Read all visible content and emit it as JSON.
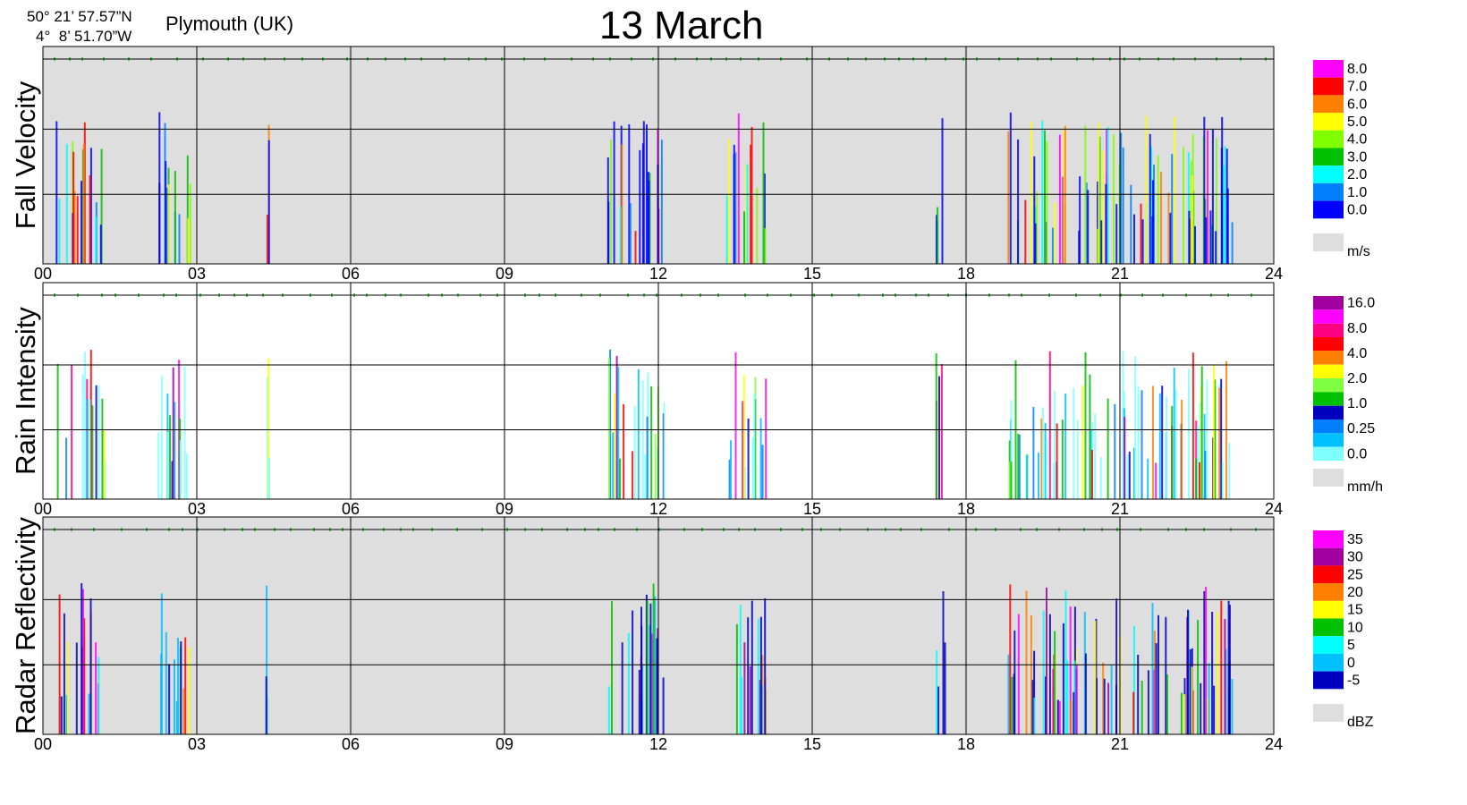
{
  "header": {
    "coord_lat": "50° 21’ 57.57”N",
    "coord_lon": "4°  8’ 51.70”W",
    "location": "Plymouth (UK)",
    "title": "13 March"
  },
  "chart_data": [
    {
      "type": "heatmap",
      "ylabel": "Fall Velocity",
      "xlabel": "",
      "x_ticks": [
        "00",
        "03",
        "06",
        "09",
        "12",
        "15",
        "18",
        "21",
        "24"
      ],
      "xlim": [
        0,
        24
      ],
      "background": "#dedede",
      "colorbar": {
        "unit": "m/s",
        "no_data_color": "#dedede",
        "labels": [
          "8.0",
          "7.0",
          "6.0",
          "5.0",
          "4.0",
          "3.0",
          "2.0",
          "1.0",
          "0.0"
        ],
        "colors": [
          "#ff00ff",
          "#ff0000",
          "#ff8000",
          "#ffff00",
          "#80ff00",
          "#00c000",
          "#00ffff",
          "#0080ff",
          "#0000ff"
        ]
      },
      "precip_intervals_h": [
        [
          0.25,
          1.2
        ],
        [
          2.2,
          2.9
        ],
        [
          4.3,
          4.4
        ],
        [
          11.0,
          12.1
        ],
        [
          13.3,
          14.1
        ],
        [
          17.4,
          17.6
        ],
        [
          18.8,
          23.2
        ]
      ]
    },
    {
      "type": "heatmap",
      "ylabel": "Rain Intensity",
      "xlabel": "",
      "x_ticks": [
        "00",
        "03",
        "06",
        "09",
        "12",
        "15",
        "18",
        "21",
        "24"
      ],
      "xlim": [
        0,
        24
      ],
      "background": "#ffffff",
      "colorbar": {
        "unit": "mm/h",
        "no_data_color": "#dedede",
        "labels": [
          "16.0",
          "8.0",
          "4.0",
          "2.0",
          "1.0",
          "0.25",
          "0.0"
        ],
        "colors": [
          "#a000a0",
          "#ff00ff",
          "#ff0080",
          "#ff0000",
          "#ff8000",
          "#ffff00",
          "#80ff40",
          "#00c000",
          "#0000c0",
          "#0080ff",
          "#00c0ff",
          "#80ffff"
        ]
      },
      "precip_intervals_h": [
        [
          0.25,
          1.2
        ],
        [
          2.2,
          2.9
        ],
        [
          4.3,
          4.4
        ],
        [
          11.0,
          12.1
        ],
        [
          13.3,
          14.1
        ],
        [
          17.4,
          17.6
        ],
        [
          18.8,
          23.2
        ]
      ]
    },
    {
      "type": "heatmap",
      "ylabel": "Radar Reflectivity",
      "xlabel": "",
      "x_ticks": [
        "00",
        "03",
        "06",
        "09",
        "12",
        "15",
        "18",
        "21",
        "24"
      ],
      "xlim": [
        0,
        24
      ],
      "background": "#dedede",
      "colorbar": {
        "unit": "dBZ",
        "no_data_color": "#dedede",
        "labels": [
          "35",
          "30",
          "25",
          "20",
          "15",
          "10",
          "5",
          "0",
          "-5"
        ],
        "colors": [
          "#ff00ff",
          "#a000a0",
          "#ff0000",
          "#ff8000",
          "#ffff00",
          "#00c000",
          "#00ffff",
          "#00c0ff",
          "#0000c0"
        ]
      },
      "precip_intervals_h": [
        [
          0.25,
          1.2
        ],
        [
          2.2,
          2.9
        ],
        [
          4.3,
          4.4
        ],
        [
          11.0,
          12.1
        ],
        [
          13.3,
          14.1
        ],
        [
          17.4,
          17.6
        ],
        [
          18.8,
          23.2
        ]
      ]
    }
  ]
}
